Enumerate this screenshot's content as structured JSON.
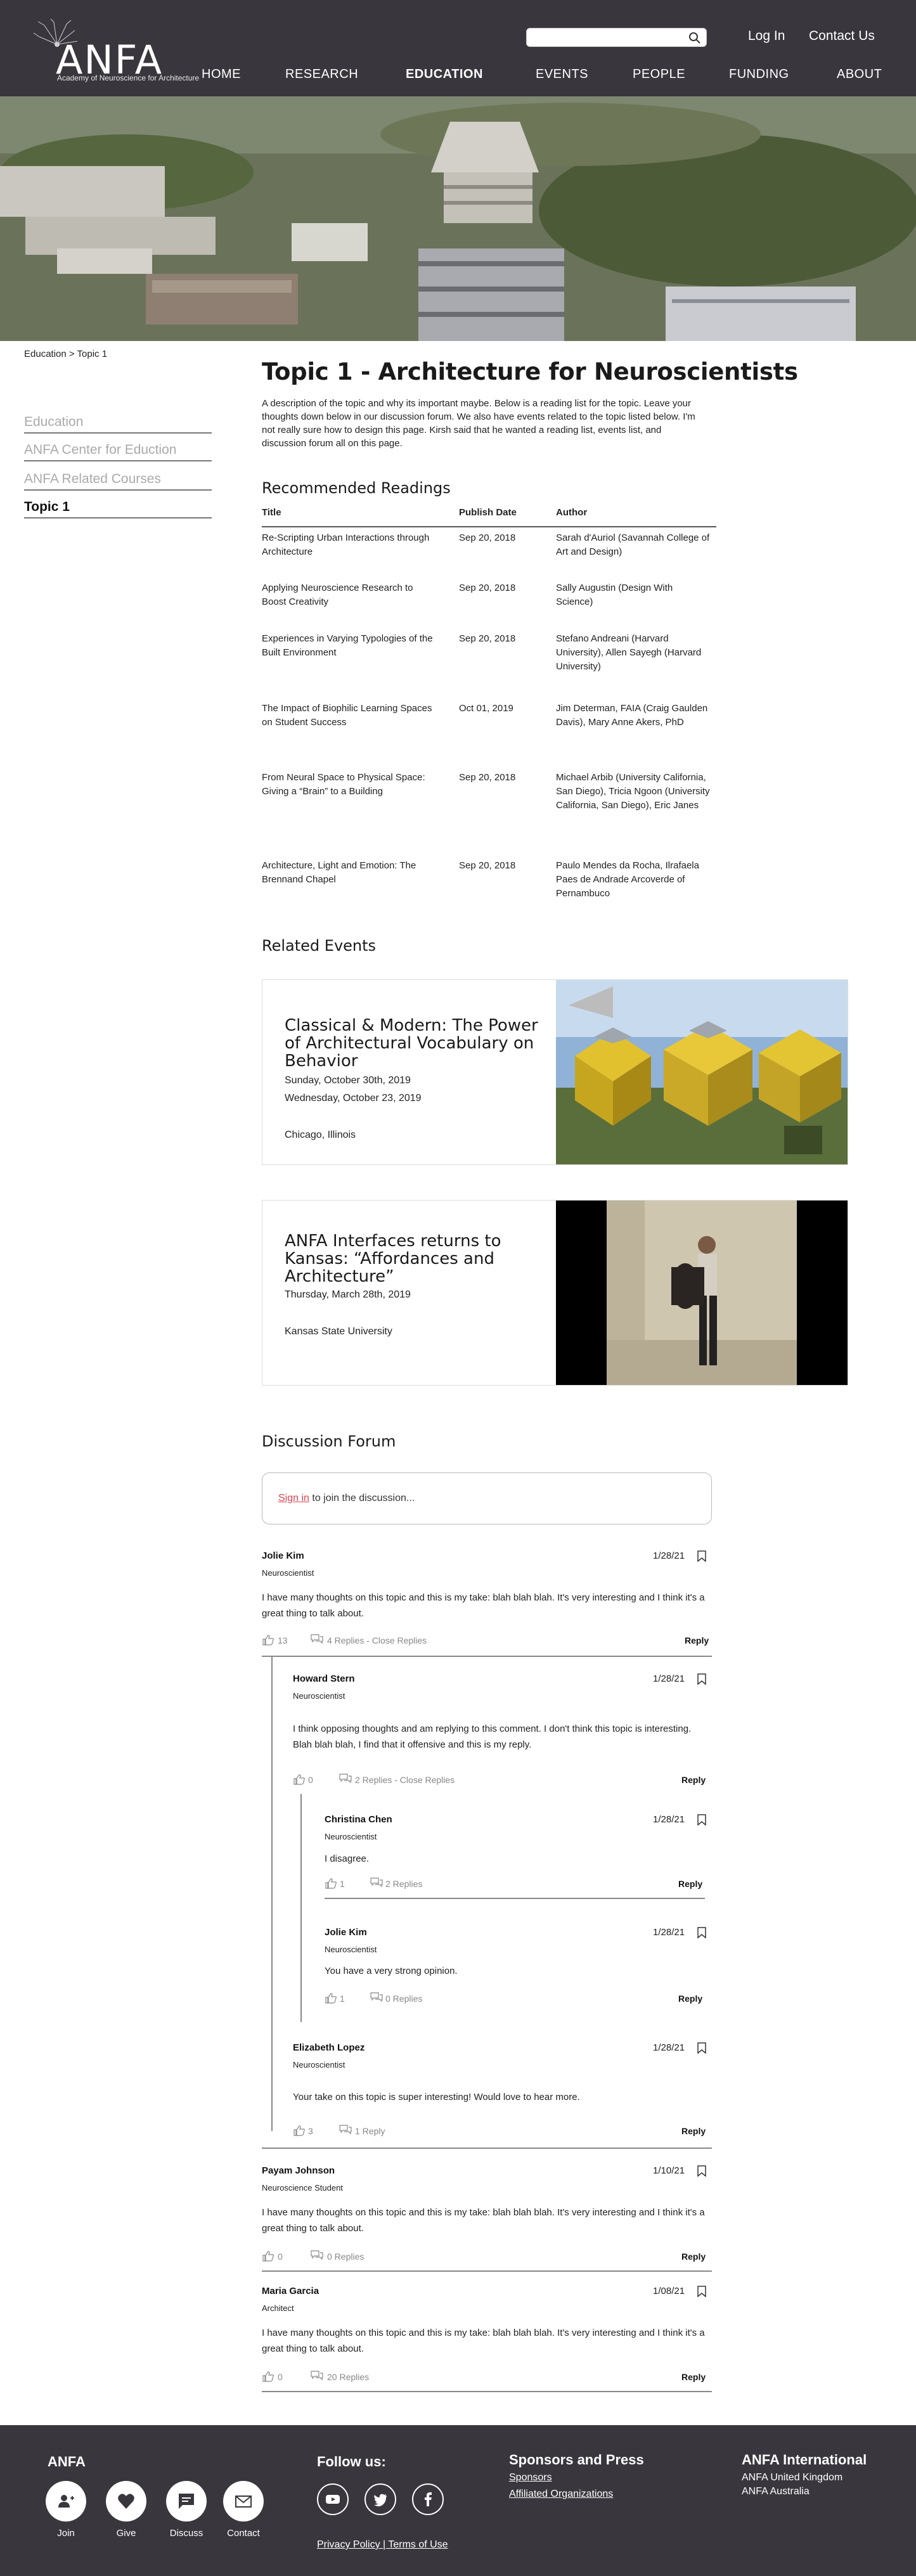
{
  "header": {
    "logo_text": "ANFA",
    "logo_sub": "Academy of Neuroscience for Architecture",
    "search_placeholder": "",
    "login": "Log In",
    "contact": "Contact Us",
    "nav": [
      "HOME",
      "RESEARCH",
      "EDUCATION",
      "EVENTS",
      "PEOPLE",
      "FUNDING",
      "ABOUT"
    ],
    "active_nav": "EDUCATION"
  },
  "breadcrumb": "Education > Topic 1",
  "sidebar": [
    "Education",
    "ANFA Center for Eduction",
    "ANFA Related Courses",
    "Topic 1"
  ],
  "page": {
    "title": "Topic 1 - Architecture for Neuroscientists",
    "intro": "A description of the topic and why its important maybe. Below is a reading list for the topic. Leave your thoughts down below in our discussion forum. We also have events related to the topic listed below. I'm not really sure how to design this page. Kirsh said that he wanted a reading list, events list, and discussion forum all on this page."
  },
  "readings": {
    "heading": "Recommended Readings",
    "columns": [
      "Title",
      "Publish Date",
      "Author"
    ],
    "rows": [
      {
        "title": "Re-Scripting Urban Interactions through Architecture",
        "date": "Sep 20, 2018",
        "author": "Sarah d'Auriol (Savannah College of Art and Design)"
      },
      {
        "title": "Applying Neuroscience Research to Boost Creativity",
        "date": "Sep 20, 2018",
        "author": "Sally Augustin (Design With Science)"
      },
      {
        "title": "Experiences in Varying Typologies of the Built Environment",
        "date": "Sep 20, 2018",
        "author": "Stefano Andreani (Harvard University), Allen Sayegh (Harvard University)"
      },
      {
        "title": "The Impact of Biophilic Learning Spaces on Student Success",
        "date": "Oct 01, 2019",
        "author": "Jim Determan, FAIA (Craig Gaulden Davis), Mary Anne Akers, PhD"
      },
      {
        "title": "From Neural Space to Physical Space: Giving a “Brain” to a Building",
        "date": "Sep 20, 2018",
        "author": "Michael Arbib (University California, San Diego), Tricia Ngoon (University California, San Diego), Eric Janes"
      },
      {
        "title": "Architecture, Light and Emotion: The Brennand Chapel",
        "date": "Sep 20, 2018",
        "author": "Paulo Mendes da Rocha, Ilrafaela Paes de Andrade Arcoverde of Pernambuco"
      }
    ]
  },
  "events": {
    "heading": "Related Events",
    "items": [
      {
        "title": "Classical & Modern: The Power of Architectural Vocabulary on Behavior",
        "dates": [
          "Sunday, October 30th, 2019",
          "Wednesday, October 23, 2019"
        ],
        "location": "Chicago, Illinois"
      },
      {
        "title": "ANFA Interfaces returns to Kansas: “Affordances and Architecture”",
        "dates": [
          "Thursday, March 28th, 2019"
        ],
        "location": "Kansas State University"
      }
    ]
  },
  "forum": {
    "heading": "Discussion Forum",
    "signin": "Sign in",
    "prompt": " to join the discussion...",
    "reply_label": "Reply",
    "comments": [
      {
        "name": "Jolie Kim",
        "role": "Neuroscientist",
        "date": "1/28/21",
        "body": "I have many thoughts on this topic and this is my take: blah blah blah. It's very interesting and I think it's a great thing to talk about.",
        "likes": "13",
        "replies": "4 Replies - Close Replies"
      },
      {
        "name": "Howard Stern",
        "role": "Neuroscientist",
        "date": "1/28/21",
        "body": "I think opposing thoughts and am replying to this comment. I don't think this topic is interesting. Blah blah blah, I find that it offensive and this is my reply.",
        "likes": "0",
        "replies": "2 Replies - Close Replies"
      },
      {
        "name": "Christina Chen",
        "role": "Neuroscientist",
        "date": "1/28/21",
        "body": "I disagree.",
        "likes": "1",
        "replies": "2 Replies"
      },
      {
        "name": "Jolie Kim",
        "role": "Neuroscientist",
        "date": "1/28/21",
        "body": "You have a very strong opinion.",
        "likes": "1",
        "replies": "0 Replies"
      },
      {
        "name": "Elizabeth Lopez",
        "role": "Neuroscientist",
        "date": "1/28/21",
        "body": "Your take on this topic is super interesting! Would love to hear more.",
        "likes": "3",
        "replies": "1 Reply"
      },
      {
        "name": "Payam Johnson",
        "role": "Neuroscience Student",
        "date": "1/10/21",
        "body": "I have many thoughts on this topic and this is my take: blah blah blah. It's very interesting and I think it's a great thing to talk about.",
        "likes": "0",
        "replies": "0 Replies"
      },
      {
        "name": "Maria Garcia",
        "role": "Architect",
        "date": "1/08/21",
        "body": "I have many thoughts on this topic and this is my take: blah blah blah. It's very interesting and I think it's a great thing to talk about.",
        "likes": "0",
        "replies": "20 Replies"
      }
    ]
  },
  "footer": {
    "anfa": "ANFA",
    "actions": [
      "Join",
      "Give",
      "Discuss",
      "Contact"
    ],
    "follow": "Follow us:",
    "policy": "Privacy Policy | Terms of Use",
    "sponsors_h": "Sponsors and Press",
    "sponsors": "Sponsors",
    "affiliated": "Affiliated Organizations",
    "intl_h": "ANFA International",
    "intl": [
      "ANFA United Kingdom",
      "ANFA Australia"
    ]
  }
}
